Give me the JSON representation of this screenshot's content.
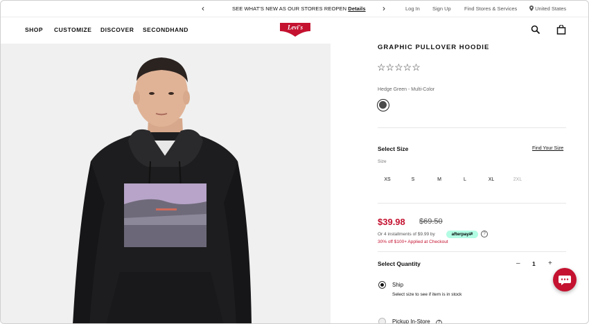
{
  "promo_bar": {
    "message": "SEE WHAT'S NEW AS OUR STORES REOPEN",
    "link": "Details",
    "prev": "‹",
    "next": "›"
  },
  "utility_nav": [
    "Log In",
    "Sign Up",
    "Find Stores & Services",
    "United States"
  ],
  "main_nav": [
    "SHOP",
    "CUSTOMIZE",
    "DISCOVER",
    "SECONDHAND"
  ],
  "brand": {
    "logo_text": "Levi's",
    "accent": "#c41230"
  },
  "icons": {
    "search": "search-icon",
    "cart": "bag-icon",
    "location": "location-pin-icon",
    "chat": "chat-icon"
  },
  "product": {
    "title": "GRAPHIC PULLOVER HOODIE",
    "rating_stars": "☆☆☆☆☆",
    "color_name": "Hedge Green - Multi-Color",
    "select_size": "Select Size",
    "find_size": "Find Your Size",
    "size_label": "Size",
    "sizes": [
      "XS",
      "S",
      "M",
      "L",
      "XL",
      "2XL"
    ],
    "price": "$39.98",
    "original_price": "$69.50",
    "installments": "Or 4 installments of $9.99 by",
    "afterpay": "afterpay⇄",
    "help": "?",
    "promo": "30% off $100+ Applied at Checkout",
    "select_quantity": "Select Quantity",
    "qty_minus": "–",
    "quantity": "1",
    "qty_plus": "+",
    "ship_label": "Ship",
    "ship_note": "Select size to see if item is in stock",
    "pickup_label": "Pickup In-Store"
  }
}
